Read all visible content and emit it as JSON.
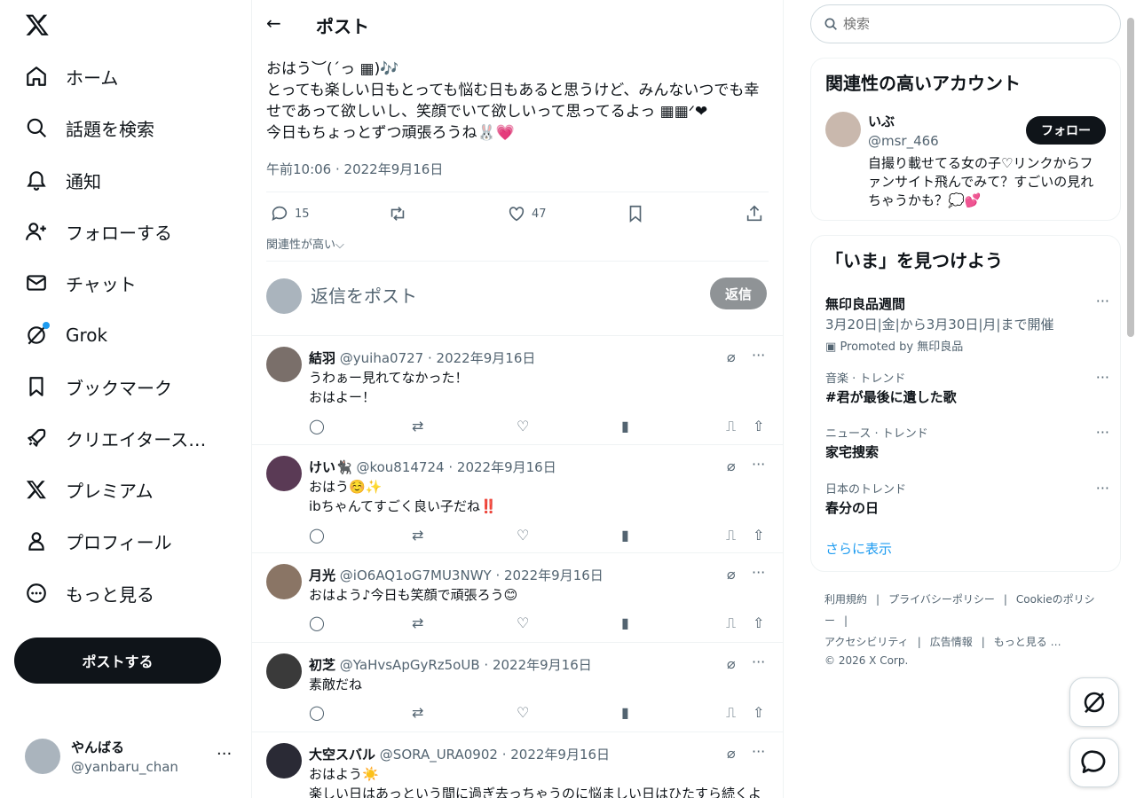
{
  "nav": {
    "items": [
      {
        "label": "ホーム",
        "icon": "home-icon"
      },
      {
        "label": "話題を検索",
        "icon": "search-icon"
      },
      {
        "label": "通知",
        "icon": "bell-icon"
      },
      {
        "label": "フォローする",
        "icon": "follow-icon"
      },
      {
        "label": "チャット",
        "icon": "mail-icon"
      },
      {
        "label": "Grok",
        "icon": "grok-icon"
      },
      {
        "label": "ブックマーク",
        "icon": "bookmark-icon"
      },
      {
        "label": "クリエイタースタ…",
        "icon": "rocket-icon"
      },
      {
        "label": "プレミアム",
        "icon": "x-icon"
      },
      {
        "label": "プロフィール",
        "icon": "person-icon"
      },
      {
        "label": "もっと見る",
        "icon": "more-circle-icon"
      }
    ],
    "post_button": "ポストする",
    "account": {
      "name": "やんばる",
      "handle": "@yanbaru_chan"
    }
  },
  "main": {
    "title": "ポスト",
    "post": {
      "text": "おはう︶(ˊっ ▦)🎶\nとっても楽しい日もとっても悩む日もあると思うけど、みんないつでも幸せであって欲しいし、笑顔でいて欲しいって思ってるよっ ▦▦ᐟ❤\n今日もちょっとずつ頑張ろうね🐰💗",
      "timestamp": "午前10:06 · 2022年9月16日",
      "replies": "15",
      "likes": "47"
    },
    "relevance_label": "関連性が高い⌵",
    "reply_placeholder": "返信をポスト",
    "reply_button": "返信",
    "replies": [
      {
        "name": "結羽",
        "handle": "@yuiha0727",
        "date": "· 2022年9月16日",
        "text": "うわぁー見れてなかった！\nおはよー！"
      },
      {
        "name": "けい🐈‍⬛",
        "handle": "@kou814724",
        "date": "· 2022年9月16日",
        "text": "おはう☺️✨\nibちゃんてすごく良い子だね‼️"
      },
      {
        "name": "月光",
        "handle": "@iO6AQ1oG7MU3NWY",
        "date": "· 2022年9月16日",
        "text": "おはよう♪今日も笑顔で頑張ろう😊"
      },
      {
        "name": "初芝",
        "handle": "@YaHvsApGyRz5oUB",
        "date": "· 2022年9月16日",
        "text": "素敵だね"
      },
      {
        "name": "大空スバル",
        "handle": "@SORA_URA0902",
        "date": "· 2022年9月16日",
        "text": "おはよう☀️\n楽しい日はあっという間に過ぎ去っちゃうのに悩ましい日はひたすら続くよ"
      }
    ]
  },
  "right": {
    "search_placeholder": "検索",
    "wtf": {
      "title": "関連性の高いアカウント",
      "name": "いぶ",
      "handle": "@msr_466",
      "follow": "フォロー",
      "bio": "自撮り載せてる女の子♡リンクからファンサイト飛んでみて？すごいの見れちゃうかも？💭💕"
    },
    "explore": {
      "title": "「いま」を見つけよう",
      "trends": [
        {
          "context": "",
          "name": "無印良品週間",
          "sub": "3月20日|金|から3月30日|月|まで開催",
          "promo": "Promoted by 無印良品"
        },
        {
          "context": "音楽 · トレンド",
          "name": "#君が最後に遺した歌",
          "sub": "",
          "promo": ""
        },
        {
          "context": "ニュース · トレンド",
          "name": "家宅捜索",
          "sub": "",
          "promo": ""
        },
        {
          "context": "日本のトレンド",
          "name": "春分の日",
          "sub": "",
          "promo": ""
        }
      ],
      "show_more": "さらに表示"
    },
    "footer": {
      "links": [
        "利用規約",
        "|",
        "プライバシーポリシー",
        "|",
        "Cookieのポリシー",
        "|",
        "アクセシビリティ",
        "|",
        "広告情報",
        "|",
        "もっと見る …"
      ],
      "copyright": "© 2026 X Corp."
    }
  },
  "colors": {
    "accent": "#1d9bf0",
    "text": "#0f1419",
    "muted": "#536471"
  }
}
